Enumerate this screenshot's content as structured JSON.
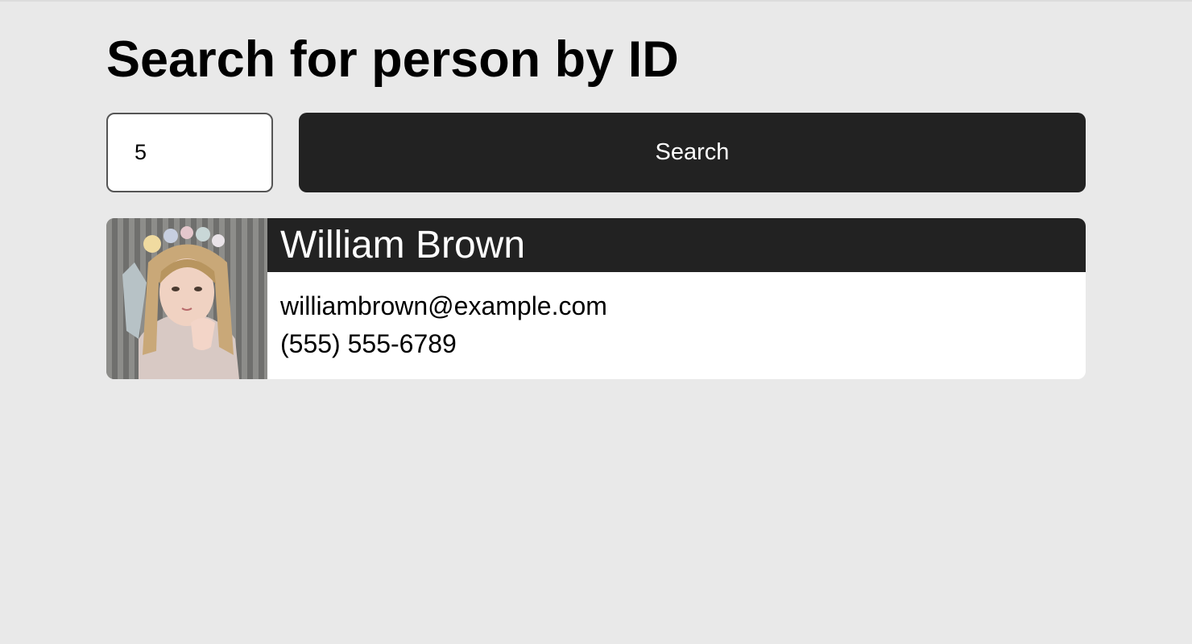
{
  "page": {
    "title": "Search for person by ID"
  },
  "search": {
    "value": "5",
    "button_label": "Search"
  },
  "result": {
    "name": "William Brown",
    "email": "williambrown@example.com",
    "phone": "(555) 555-6789",
    "avatar_icon": "person-photo"
  },
  "colors": {
    "background": "#e9e9e9",
    "dark": "#222222",
    "card": "#ffffff"
  }
}
